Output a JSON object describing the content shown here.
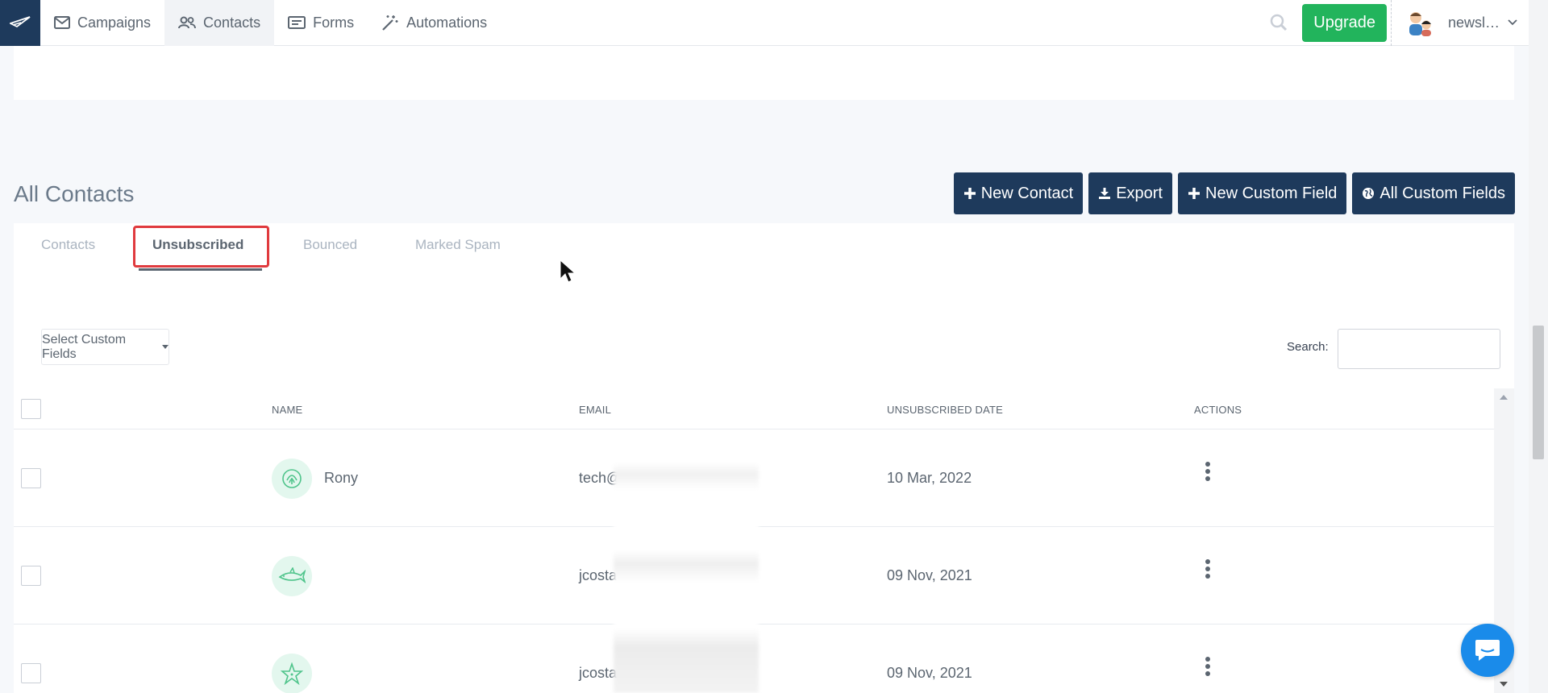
{
  "nav": {
    "items": [
      {
        "label": "Campaigns",
        "icon": "envelope-icon"
      },
      {
        "label": "Contacts",
        "icon": "users-icon",
        "active": true
      },
      {
        "label": "Forms",
        "icon": "form-icon"
      },
      {
        "label": "Automations",
        "icon": "magic-wand-icon"
      }
    ],
    "upgrade_label": "Upgrade",
    "user_name": "newsl…"
  },
  "section": {
    "title": "All Contacts",
    "actions": [
      {
        "label": "New Contact",
        "icon": "plus-icon"
      },
      {
        "label": "Export",
        "icon": "download-icon"
      },
      {
        "label": "New Custom Field",
        "icon": "plus-icon"
      },
      {
        "label": "All Custom Fields",
        "icon": "globe-icon"
      }
    ]
  },
  "tabs": [
    {
      "label": "Contacts"
    },
    {
      "label": "Unsubscribed",
      "active": true
    },
    {
      "label": "Bounced"
    },
    {
      "label": "Marked Spam"
    }
  ],
  "filters": {
    "custom_fields_label": "Select Custom Fields",
    "search_label": "Search:",
    "search_value": ""
  },
  "table": {
    "columns": [
      "NAME",
      "EMAIL",
      "UNSUBSCRIBED DATE",
      "ACTIONS"
    ],
    "rows": [
      {
        "name": "Rony",
        "email": "tech@",
        "date": "10 Mar, 2022",
        "avatar": "fingerprint-icon"
      },
      {
        "name": "",
        "email": "jcosta",
        "date": "09 Nov, 2021",
        "avatar": "shark-icon"
      },
      {
        "name": "",
        "email": "jcosta",
        "date": "09 Nov, 2021",
        "avatar": "starfish-icon"
      }
    ]
  },
  "colors": {
    "navy": "#1e3a5c",
    "green": "#22b45c",
    "highlight": "#e03a3e",
    "chat": "#1a8bea"
  }
}
